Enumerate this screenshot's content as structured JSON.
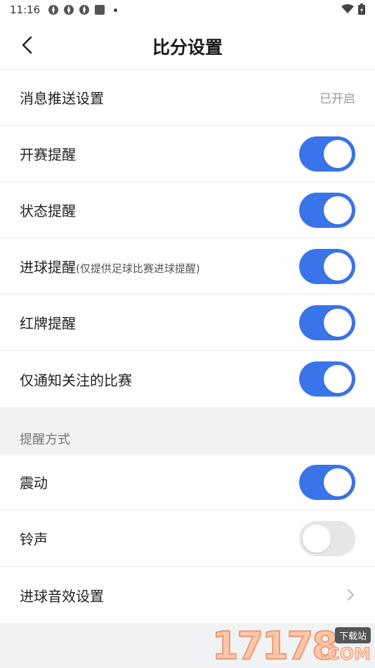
{
  "status_bar": {
    "time": "11:16",
    "left_icons": [
      "app-icon",
      "app-icon",
      "app-icon",
      "square-icon",
      "dot-icon"
    ],
    "right_icons": [
      "wifi-icon",
      "battery-icon"
    ]
  },
  "header": {
    "title": "比分设置",
    "back_icon": "chevron-left-icon"
  },
  "push_settings": {
    "label": "消息推送设置",
    "value": "已开启"
  },
  "reminders": [
    {
      "label": "开赛提醒",
      "note": "",
      "state": "on"
    },
    {
      "label": "状态提醒",
      "note": "",
      "state": "on"
    },
    {
      "label": "进球提醒",
      "note": "(仅提供足球比赛进球提醒)",
      "state": "on"
    },
    {
      "label": "红牌提醒",
      "note": "",
      "state": "on"
    },
    {
      "label": "仅通知关注的比赛",
      "note": "",
      "state": "on"
    }
  ],
  "reminder_method_section": {
    "title": "提醒方式"
  },
  "method_items": [
    {
      "label": "震动",
      "state": "on"
    },
    {
      "label": "铃声",
      "state": "off"
    }
  ],
  "goal_sound": {
    "label": "进球音效设置",
    "icon": "chevron-right-icon"
  },
  "watermark": {
    "number": "17178",
    "tag": "下载站",
    "suffix": ".COM"
  },
  "colors": {
    "accent": "#3a74ea",
    "toggle_off": "#e6e6e6",
    "page_bg": "#f1f2f4"
  }
}
